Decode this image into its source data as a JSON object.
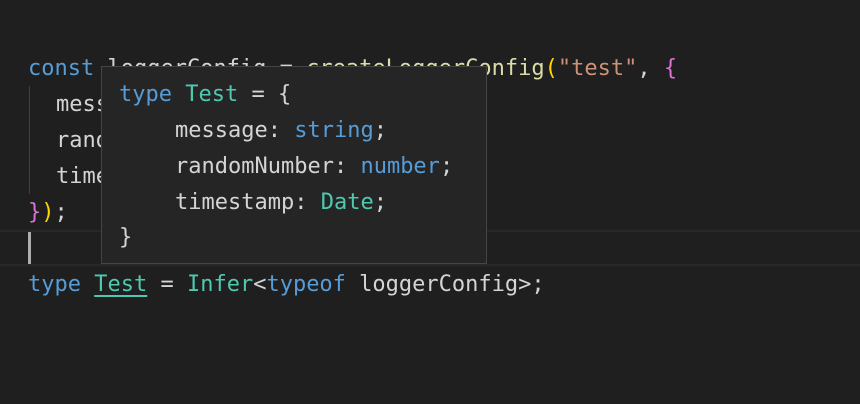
{
  "code": {
    "line1": {
      "kw_const": "const",
      "name": " loggerConfig",
      "eq": " = ",
      "fn": "createLoggerConfig",
      "open_paren": "(",
      "arg": "\"test\"",
      "comma": ", ",
      "open_brace": "{"
    },
    "line2": {
      "text": "message"
    },
    "line3": {
      "text": "randomNumber"
    },
    "line4": {
      "text": "timestamp"
    },
    "line5": {
      "close_brace": "}",
      "close_paren": ")",
      "semi": ";"
    },
    "line7": {
      "kw_type": "type",
      "type_name": "Test",
      "eq": " = ",
      "infer": "Infer",
      "lt": "<",
      "kw_typeof": "typeof",
      "ref": " loggerConfig",
      "gt_semi": ">;"
    }
  },
  "hover": {
    "kw_type": "type",
    "type_name": "Test",
    "eq_brace": " = {",
    "fields": [
      {
        "name": "message",
        "colon": ": ",
        "type": "string",
        "semi": ";"
      },
      {
        "name": "randomNumber",
        "colon": ": ",
        "type": "number",
        "semi": ";"
      },
      {
        "name": "timestamp",
        "colon": ": ",
        "type": "Date",
        "semi": ";"
      }
    ],
    "close": "}"
  },
  "colors": {
    "background": "#1f1f1f",
    "keyword": "#569cd6",
    "function": "#dcdcaa",
    "string": "#ce9178",
    "type": "#4ec9b0",
    "text": "#d4d4d4",
    "bracket_level1": "#ffd700",
    "bracket_level2": "#da70d6",
    "hover_bg": "#252526"
  }
}
